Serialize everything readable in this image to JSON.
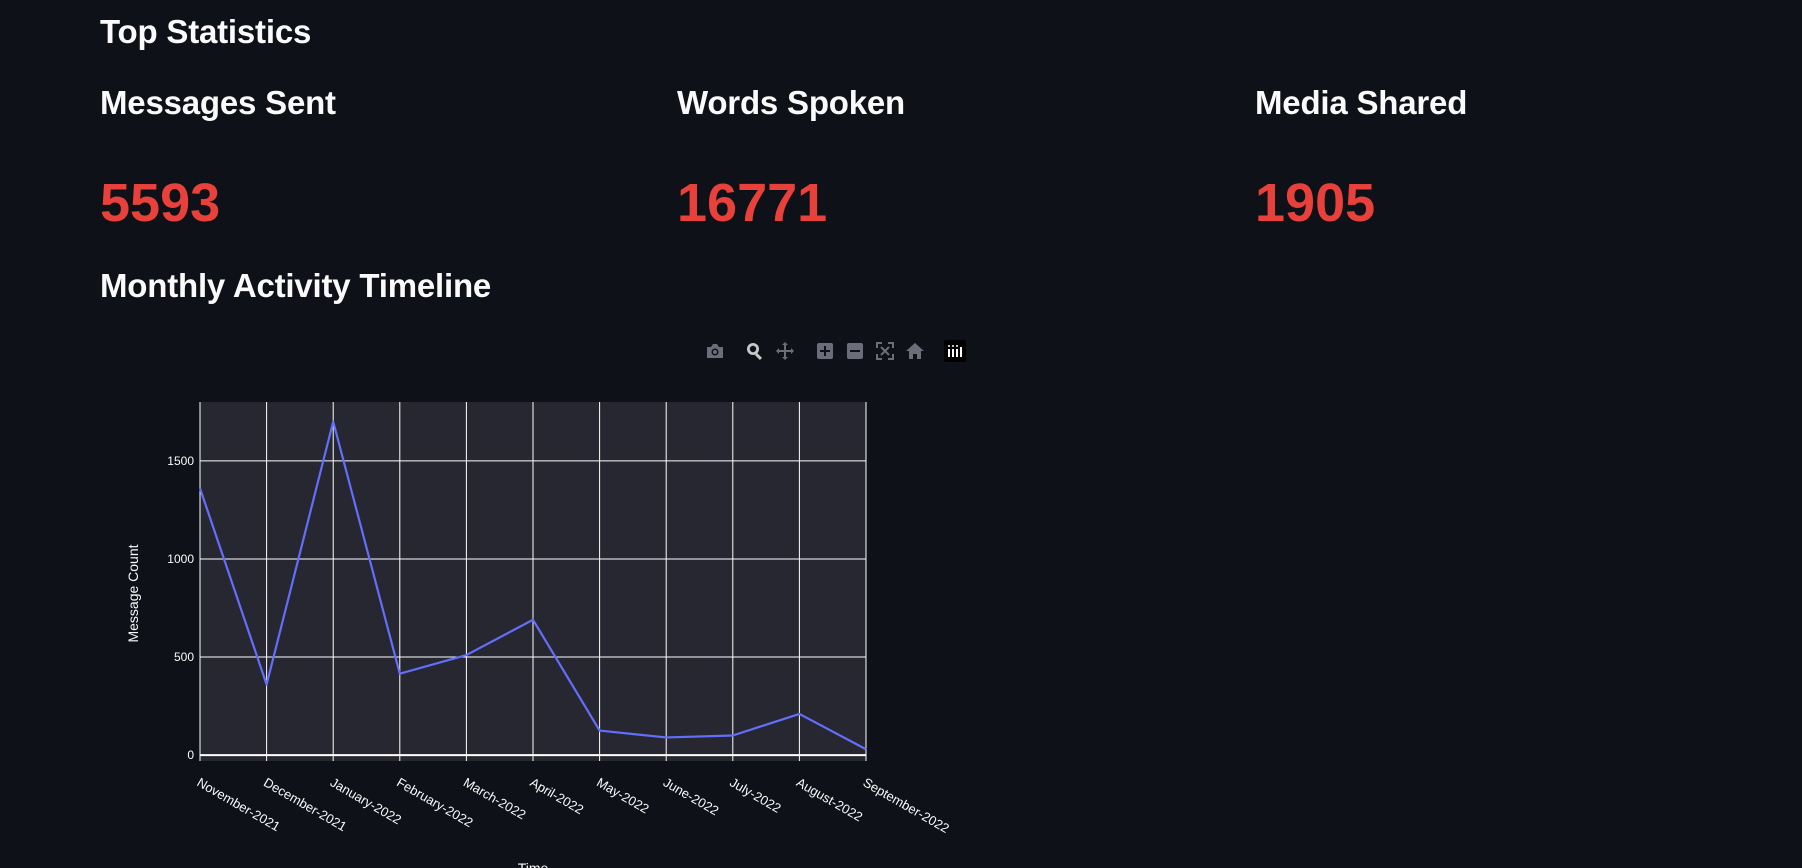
{
  "headings": {
    "top_statistics": "Top Statistics",
    "timeline": "Monthly Activity Timeline"
  },
  "metrics": [
    {
      "label": "Messages Sent",
      "value": "5593"
    },
    {
      "label": "Words Spoken",
      "value": "16771"
    },
    {
      "label": "Media Shared",
      "value": "1905"
    }
  ],
  "modebar": {
    "icons": [
      "camera-icon",
      "zoom-icon",
      "pan-icon",
      "zoom-in-icon",
      "zoom-out-icon",
      "autoscale-icon",
      "reset-axes-icon",
      "plotly-logo-icon"
    ]
  },
  "colors": {
    "background": "#0e1117",
    "metric_value": "#e8413b",
    "plot_bg": "#262730",
    "line": "#636efa",
    "grid": "#ffffff"
  },
  "chart_data": {
    "type": "line",
    "categories": [
      "November-2021",
      "December-2021",
      "January-2022",
      "February-2022",
      "March-2022",
      "April-2022",
      "May-2022",
      "June-2022",
      "July-2022",
      "August-2022",
      "September-2022"
    ],
    "values": [
      1360,
      360,
      1700,
      415,
      510,
      690,
      125,
      90,
      100,
      210,
      30
    ],
    "xlabel": "Time",
    "ylabel": "Message Count",
    "yticks": [
      "0",
      "500",
      "1000",
      "1500"
    ],
    "ylim": [
      -30,
      1800
    ]
  }
}
